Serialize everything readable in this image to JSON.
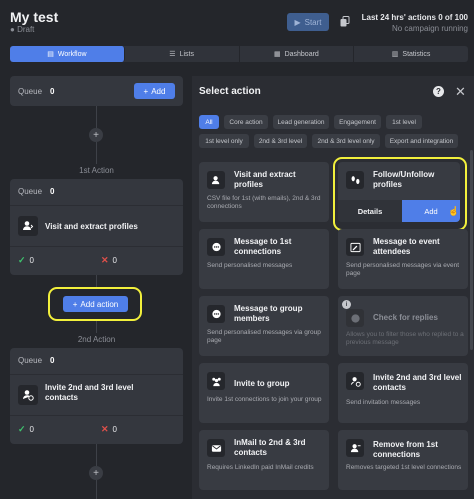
{
  "header": {
    "title": "My test",
    "status": "Draft",
    "start_label": "Start",
    "stats_title": "Last 24 hrs' actions 0 of 100",
    "stats_sub": "No campaign running"
  },
  "tabs": [
    {
      "label": "Workflow",
      "active": true
    },
    {
      "label": "Lists"
    },
    {
      "label": "Dashboard"
    },
    {
      "label": "Statistics"
    }
  ],
  "queue1": {
    "label": "Queue",
    "count": "0",
    "add_label": "Add"
  },
  "action1": {
    "heading": "1st Action",
    "name": "Visit and extract profiles",
    "success": "0",
    "fail": "0"
  },
  "add_action_label": "Add action",
  "action2": {
    "heading": "2nd Action",
    "queue_label": "Queue",
    "queue_count": "0",
    "name": "Invite 2nd and 3rd level contacts",
    "success": "0",
    "fail": "0"
  },
  "select_action": {
    "title": "Select action",
    "filters_row1": [
      "All",
      "Core action",
      "Lead generation",
      "Engagement",
      "1st level"
    ],
    "filters_row2": [
      "1st level only",
      "2nd & 3rd level",
      "2nd & 3rd level only",
      "Export and integration"
    ],
    "options": [
      {
        "title": "Visit and extract profiles",
        "desc": "CSV file for 1st (with emails), 2nd & 3rd connections"
      },
      {
        "title": "Follow/Unfollow profiles",
        "details_label": "Details",
        "add_label": "Add"
      },
      {
        "title": "Message to 1st connections",
        "desc": "Send personalised messages"
      },
      {
        "title": "Message to event attendees",
        "desc": "Send personalised messages via event page"
      },
      {
        "title": "Message to group members",
        "desc": "Send personalised messages via group page"
      },
      {
        "title": "Check for replies",
        "desc": "Allows you to filter those who replied to a previous message"
      },
      {
        "title": "Invite to group",
        "desc": "Invite 1st connections to join your group"
      },
      {
        "title": "Invite 2nd and 3rd level contacts",
        "desc": "Send invitation messages"
      },
      {
        "title": "InMail to 2nd & 3rd contacts",
        "desc": "Requires LinkedIn paid InMail credits"
      },
      {
        "title": "Remove from 1st connections",
        "desc": "Removes targeted 1st level connections"
      }
    ]
  },
  "colors": {
    "accent": "#4f7ee8",
    "highlight": "#f2f03c",
    "success": "#3ec46d",
    "fail": "#e0504a"
  }
}
